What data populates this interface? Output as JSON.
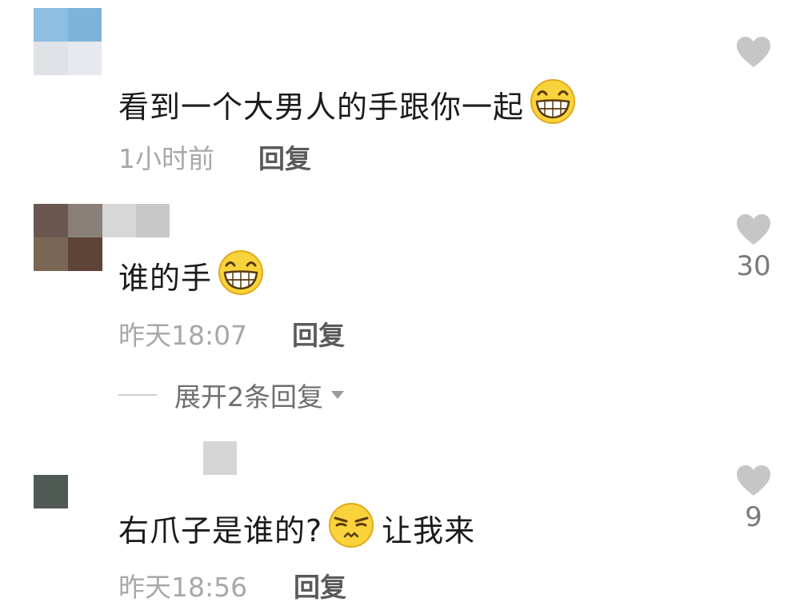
{
  "comments": [
    {
      "text": "看到一个大男人的手跟你一起",
      "emoji": "grinning-face-emoji",
      "time": "1小时前",
      "reply": "回复",
      "likes": ""
    },
    {
      "text": "谁的手",
      "emoji": "grinning-face-emoji",
      "time": "昨天18:07",
      "reply": "回复",
      "likes": "30",
      "expand_label": "展开2条回复"
    },
    {
      "text_before": "右爪子是谁的?",
      "emoji": "smirking-face-emoji",
      "text_after": "让我来",
      "time": "昨天18:56",
      "reply": "回复",
      "likes": "9"
    }
  ],
  "colors": {
    "heart": "#c6c6c6",
    "time": "#a8a8a8",
    "reply": "#5a5a5a",
    "emoji_yellow": "#f9d33b"
  }
}
